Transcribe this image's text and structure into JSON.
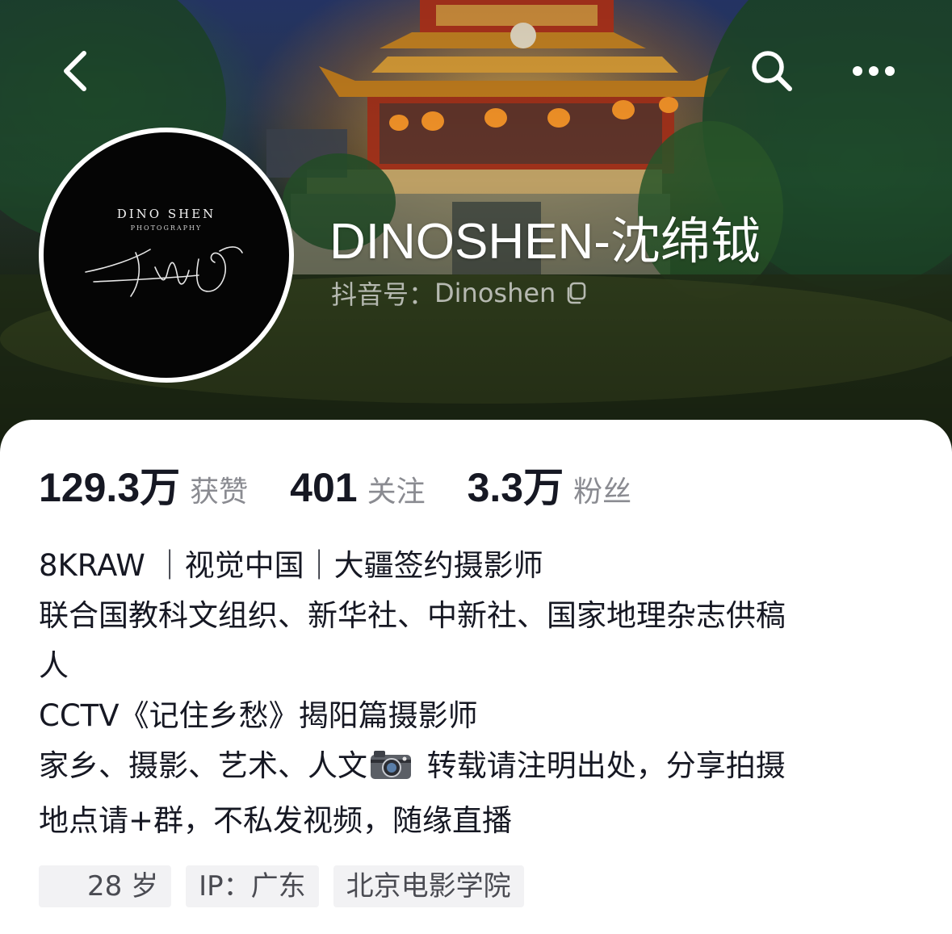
{
  "header": {
    "back_icon": "chevron-left-icon",
    "search_icon": "search-icon",
    "more_icon": "more-dots-icon"
  },
  "profile": {
    "avatar_brand": "DINO SHEN",
    "avatar_sub": "PHOTOGRAPHY",
    "nickname": "DINOSHEN-沈绵钺",
    "account_label": "抖音号：",
    "account_id": "Dinoshen",
    "copy_icon": "copy-icon"
  },
  "stats": [
    {
      "value": "129.3万",
      "label": "获赞"
    },
    {
      "value": "401",
      "label": "关注"
    },
    {
      "value": "3.3万",
      "label": "粉丝"
    }
  ],
  "bio": {
    "line1": "8KRAW ｜视觉中国｜大疆签约摄影师",
    "line2": "联合国教科文组织、新华社、中新社、国家地理杂志供稿",
    "line3": "人",
    "line4": "CCTV《记住乡愁》揭阳篇摄影师",
    "line5_a": "家乡、摄影、艺术、人文",
    "line5_icon": "camera-icon",
    "line5_b": " 转载请注明出处，分享拍摄",
    "line6": "地点请+群，不私发视频，随缘直播"
  },
  "tags": [
    {
      "text": "28 岁"
    },
    {
      "text": "IP：广东"
    },
    {
      "text": "北京电影学院"
    }
  ],
  "colors": {
    "text_primary": "#161823",
    "text_secondary": "#8a8b91",
    "tag_bg": "#f2f2f4"
  }
}
